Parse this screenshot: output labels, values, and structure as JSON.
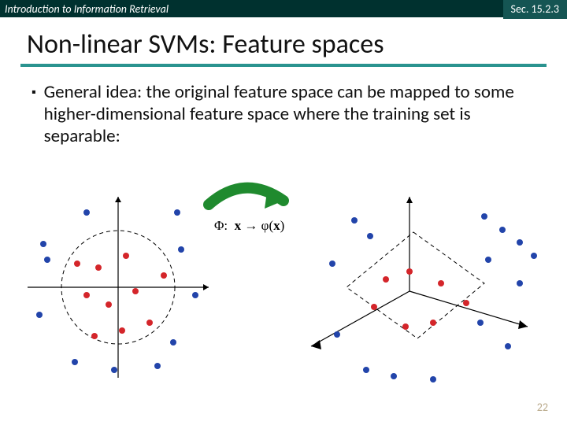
{
  "header": {
    "course": "Introduction to Information Retrieval",
    "section": "Sec. 15.2.3"
  },
  "title": "Non-linear SVMs:  Feature spaces",
  "bullet_text": "General idea:  the original feature space can be mapped to some higher-dimensional feature space where the training set is separable:",
  "mapping_label": "Φ:  x → φ(x)",
  "page_number": "22",
  "chart_data": {
    "type": "diagram",
    "description": "Two scatter plots illustrating feature-space mapping",
    "left_plot": {
      "axes": "2D Cartesian axes (x, y) with a dashed circle at radius ~70",
      "red_points_inside_circle": [
        [
          -52,
          30
        ],
        [
          -25,
          25
        ],
        [
          10,
          40
        ],
        [
          -40,
          -10
        ],
        [
          -12,
          -22
        ],
        [
          22,
          -5
        ],
        [
          40,
          -45
        ],
        [
          58,
          15
        ],
        [
          5,
          -55
        ],
        [
          -30,
          -62
        ]
      ],
      "blue_points_outside_circle": [
        [
          -95,
          55
        ],
        [
          -90,
          35
        ],
        [
          80,
          48
        ],
        [
          98,
          -10
        ],
        [
          70,
          -70
        ],
        [
          -100,
          -35
        ],
        [
          -55,
          -95
        ],
        [
          -5,
          -105
        ],
        [
          50,
          -100
        ],
        [
          -40,
          95
        ],
        [
          75,
          95
        ]
      ]
    },
    "arrow": "curved green arrow from left plot to right plot labeled Φ: x → φ(x)",
    "right_plot": {
      "axes": "3D-looking axes drawn in 2D with a tilted dashed square separating surface",
      "red_points": [
        [
          0,
          25
        ],
        [
          40,
          10
        ],
        [
          75,
          -20
        ],
        [
          35,
          -55
        ],
        [
          -5,
          -70
        ],
        [
          -45,
          -35
        ],
        [
          -30,
          10
        ]
      ],
      "blue_points": [
        [
          110,
          90
        ],
        [
          130,
          70
        ],
        [
          150,
          60
        ],
        [
          165,
          45
        ],
        [
          105,
          35
        ],
        [
          145,
          10
        ],
        [
          90,
          -20
        ],
        [
          130,
          -55
        ],
        [
          -85,
          85
        ],
        [
          -60,
          70
        ],
        [
          -110,
          30
        ],
        [
          -60,
          -95
        ],
        [
          -25,
          -105
        ],
        [
          30,
          -115
        ],
        [
          -95,
          -60
        ]
      ]
    }
  }
}
